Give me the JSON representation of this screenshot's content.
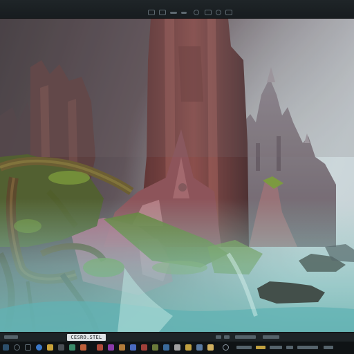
{
  "window": {
    "title": ""
  },
  "toolbar": {
    "items": [
      {
        "name": "window-icon"
      },
      {
        "name": "image-icon"
      },
      {
        "name": "fit-icon"
      },
      {
        "name": "minus-icon"
      },
      {
        "name": "zoom-out-icon"
      },
      {
        "name": "zoom-in-icon"
      },
      {
        "name": "settings-icon"
      }
    ]
  },
  "canvas": {
    "description_hidden": true,
    "colors": {
      "sky_top": "#3b3236",
      "sky_mid": "#6b5d63",
      "sky_right": "#b7bcc2",
      "tower": "#7a3f3a",
      "tower_light": "#b9797a",
      "foliage": "#6b8a2c",
      "mist": "#8fd0cc",
      "water": "#5fb3b4",
      "rock": "#3f4a45"
    }
  },
  "status": {
    "filename": "CESRO.STEL",
    "zoom": ""
  },
  "taskbar": {
    "icons": [
      {
        "name": "start-icon",
        "color": "#2c4f6b"
      },
      {
        "name": "search-icon",
        "color": "#3c4a52"
      },
      {
        "name": "task-view-icon",
        "color": "#3c4a52"
      },
      {
        "name": "browser-icon",
        "color": "#3a78c8"
      },
      {
        "name": "files-icon",
        "color": "#c8a23a"
      },
      {
        "name": "terminal-icon",
        "color": "#4a4f55"
      },
      {
        "name": "viewer-icon",
        "color": "#b04a3a"
      },
      {
        "name": "editor-icon",
        "color": "#8a3aa8"
      },
      {
        "name": "app-icon-1",
        "color": "#3a8a6a"
      },
      {
        "name": "app-icon-2",
        "color": "#c0603a"
      },
      {
        "name": "app-icon-3",
        "color": "#4a6ac0"
      },
      {
        "name": "app-icon-4",
        "color": "#a0a0a0"
      }
    ],
    "clock_time": "",
    "clock_date": ""
  }
}
